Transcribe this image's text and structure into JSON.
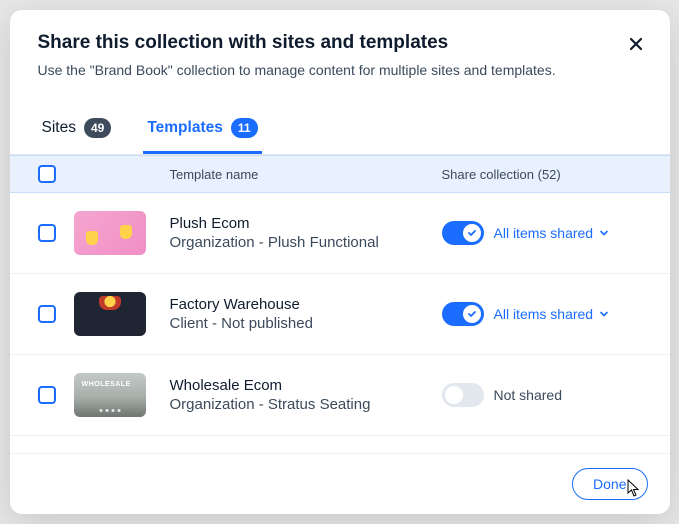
{
  "header": {
    "title": "Share this collection with sites and templates",
    "subtitle": "Use the \"Brand Book\" collection to manage content for multiple sites and templates."
  },
  "tabs": {
    "sites": {
      "label": "Sites",
      "count": "49"
    },
    "templates": {
      "label": "Templates",
      "count": "11"
    }
  },
  "columns": {
    "name": "Template name",
    "share": "Share collection (52)"
  },
  "rows": [
    {
      "title": "Plush Ecom",
      "sub": "Organization - Plush Functional",
      "shared": true
    },
    {
      "title": "Factory Warehouse",
      "sub": "Client - Not published",
      "shared": true
    },
    {
      "title": "Wholesale Ecom",
      "sub": "Organization - Stratus Seating",
      "shared": false
    }
  ],
  "share_labels": {
    "on": "All items shared",
    "off": "Not shared"
  },
  "footer": {
    "done": "Done"
  }
}
